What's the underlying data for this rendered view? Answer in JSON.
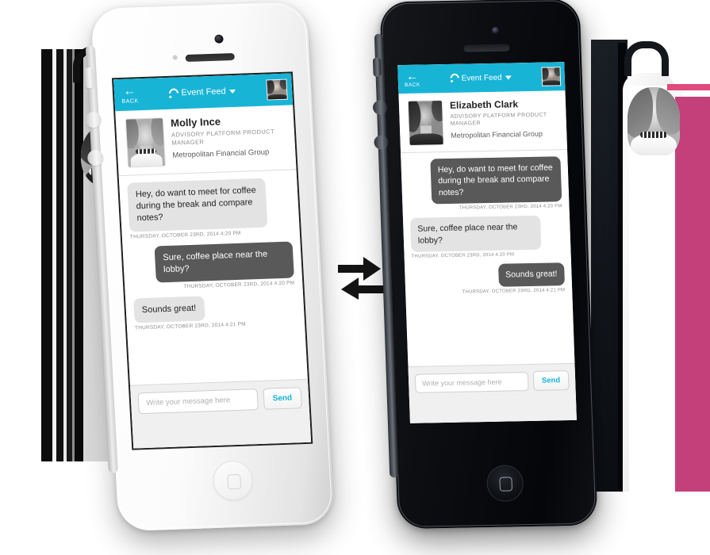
{
  "scene": {
    "title": "Two smartphones showing a chat conversation in the Event Feed app",
    "exchange_icon": "two-way-arrows-icon",
    "colors": {
      "accent_cyan": "#17b4d6",
      "bubble_incoming": "#e3e3e3",
      "bubble_outgoing": "#595959",
      "background_pink": "#c4407a",
      "background_pink_light": "#e0527f",
      "background_grey": "#969696",
      "background_purple": "#8f5d89",
      "phone_white": "#f7f7f7",
      "phone_black": "#0b0d10"
    }
  },
  "phone_white": {
    "device": "white-smartphone",
    "navbar": {
      "back_label": "BACK",
      "back_icon": "arrow-left-icon",
      "title": "Event Feed",
      "feed_icon": "rss-feed-icon",
      "dropdown_icon": "caret-down-icon",
      "avatar_icon": "user-avatar-thumbnail"
    },
    "profile": {
      "photo_icon": "profile-photo",
      "name": "Molly Ince",
      "role": "Advisory Platform Product Manager",
      "organization": "Metropolitan Financial Group"
    },
    "messages": [
      {
        "align": "left",
        "tone": "light",
        "text": "Hey, do want to meet for coffee during the break and compare notes?",
        "timestamp": "THURSDAY, OCTOBER 23RD, 2014 4:20 PM"
      },
      {
        "align": "right",
        "tone": "dark",
        "text": "Sure, coffee place near the lobby?",
        "timestamp": "THURSDAY, OCTOBER 23RD, 2014 4:20 PM"
      },
      {
        "align": "left",
        "tone": "light",
        "text": "Sounds great!",
        "timestamp": "THURSDAY, OCTOBER 23RD, 2014 4:21 PM"
      }
    ],
    "composer": {
      "placeholder": "Write your message here",
      "value": "",
      "send_label": "Send"
    }
  },
  "phone_black": {
    "device": "black-smartphone",
    "navbar": {
      "back_label": "BACK",
      "back_icon": "arrow-left-icon",
      "title": "Event Feed",
      "feed_icon": "rss-feed-icon",
      "dropdown_icon": "caret-down-icon",
      "avatar_icon": "user-avatar-thumbnail"
    },
    "profile": {
      "photo_icon": "profile-photo",
      "name": "Elizabeth Clark",
      "role": "Advisory Platform Product Manager",
      "organization": "Metropolitan Financial Group"
    },
    "messages": [
      {
        "align": "right",
        "tone": "dark",
        "text": "Hey, do want to meet for coffee during the break and compare notes?",
        "timestamp": "THURSDAY, OCTOBER 23RD, 2014 4:20 PM"
      },
      {
        "align": "left",
        "tone": "light",
        "text": "Sure, coffee place near the lobby?",
        "timestamp": "THURSDAY, OCTOBER 23RD, 2014 4:20 PM"
      },
      {
        "align": "right",
        "tone": "dark",
        "text": "Sounds great!",
        "timestamp": "THURSDAY, OCTOBER 23RD, 2014 4:21 PM"
      }
    ],
    "composer": {
      "placeholder": "Write your message here",
      "value": "",
      "send_label": "Send"
    }
  }
}
